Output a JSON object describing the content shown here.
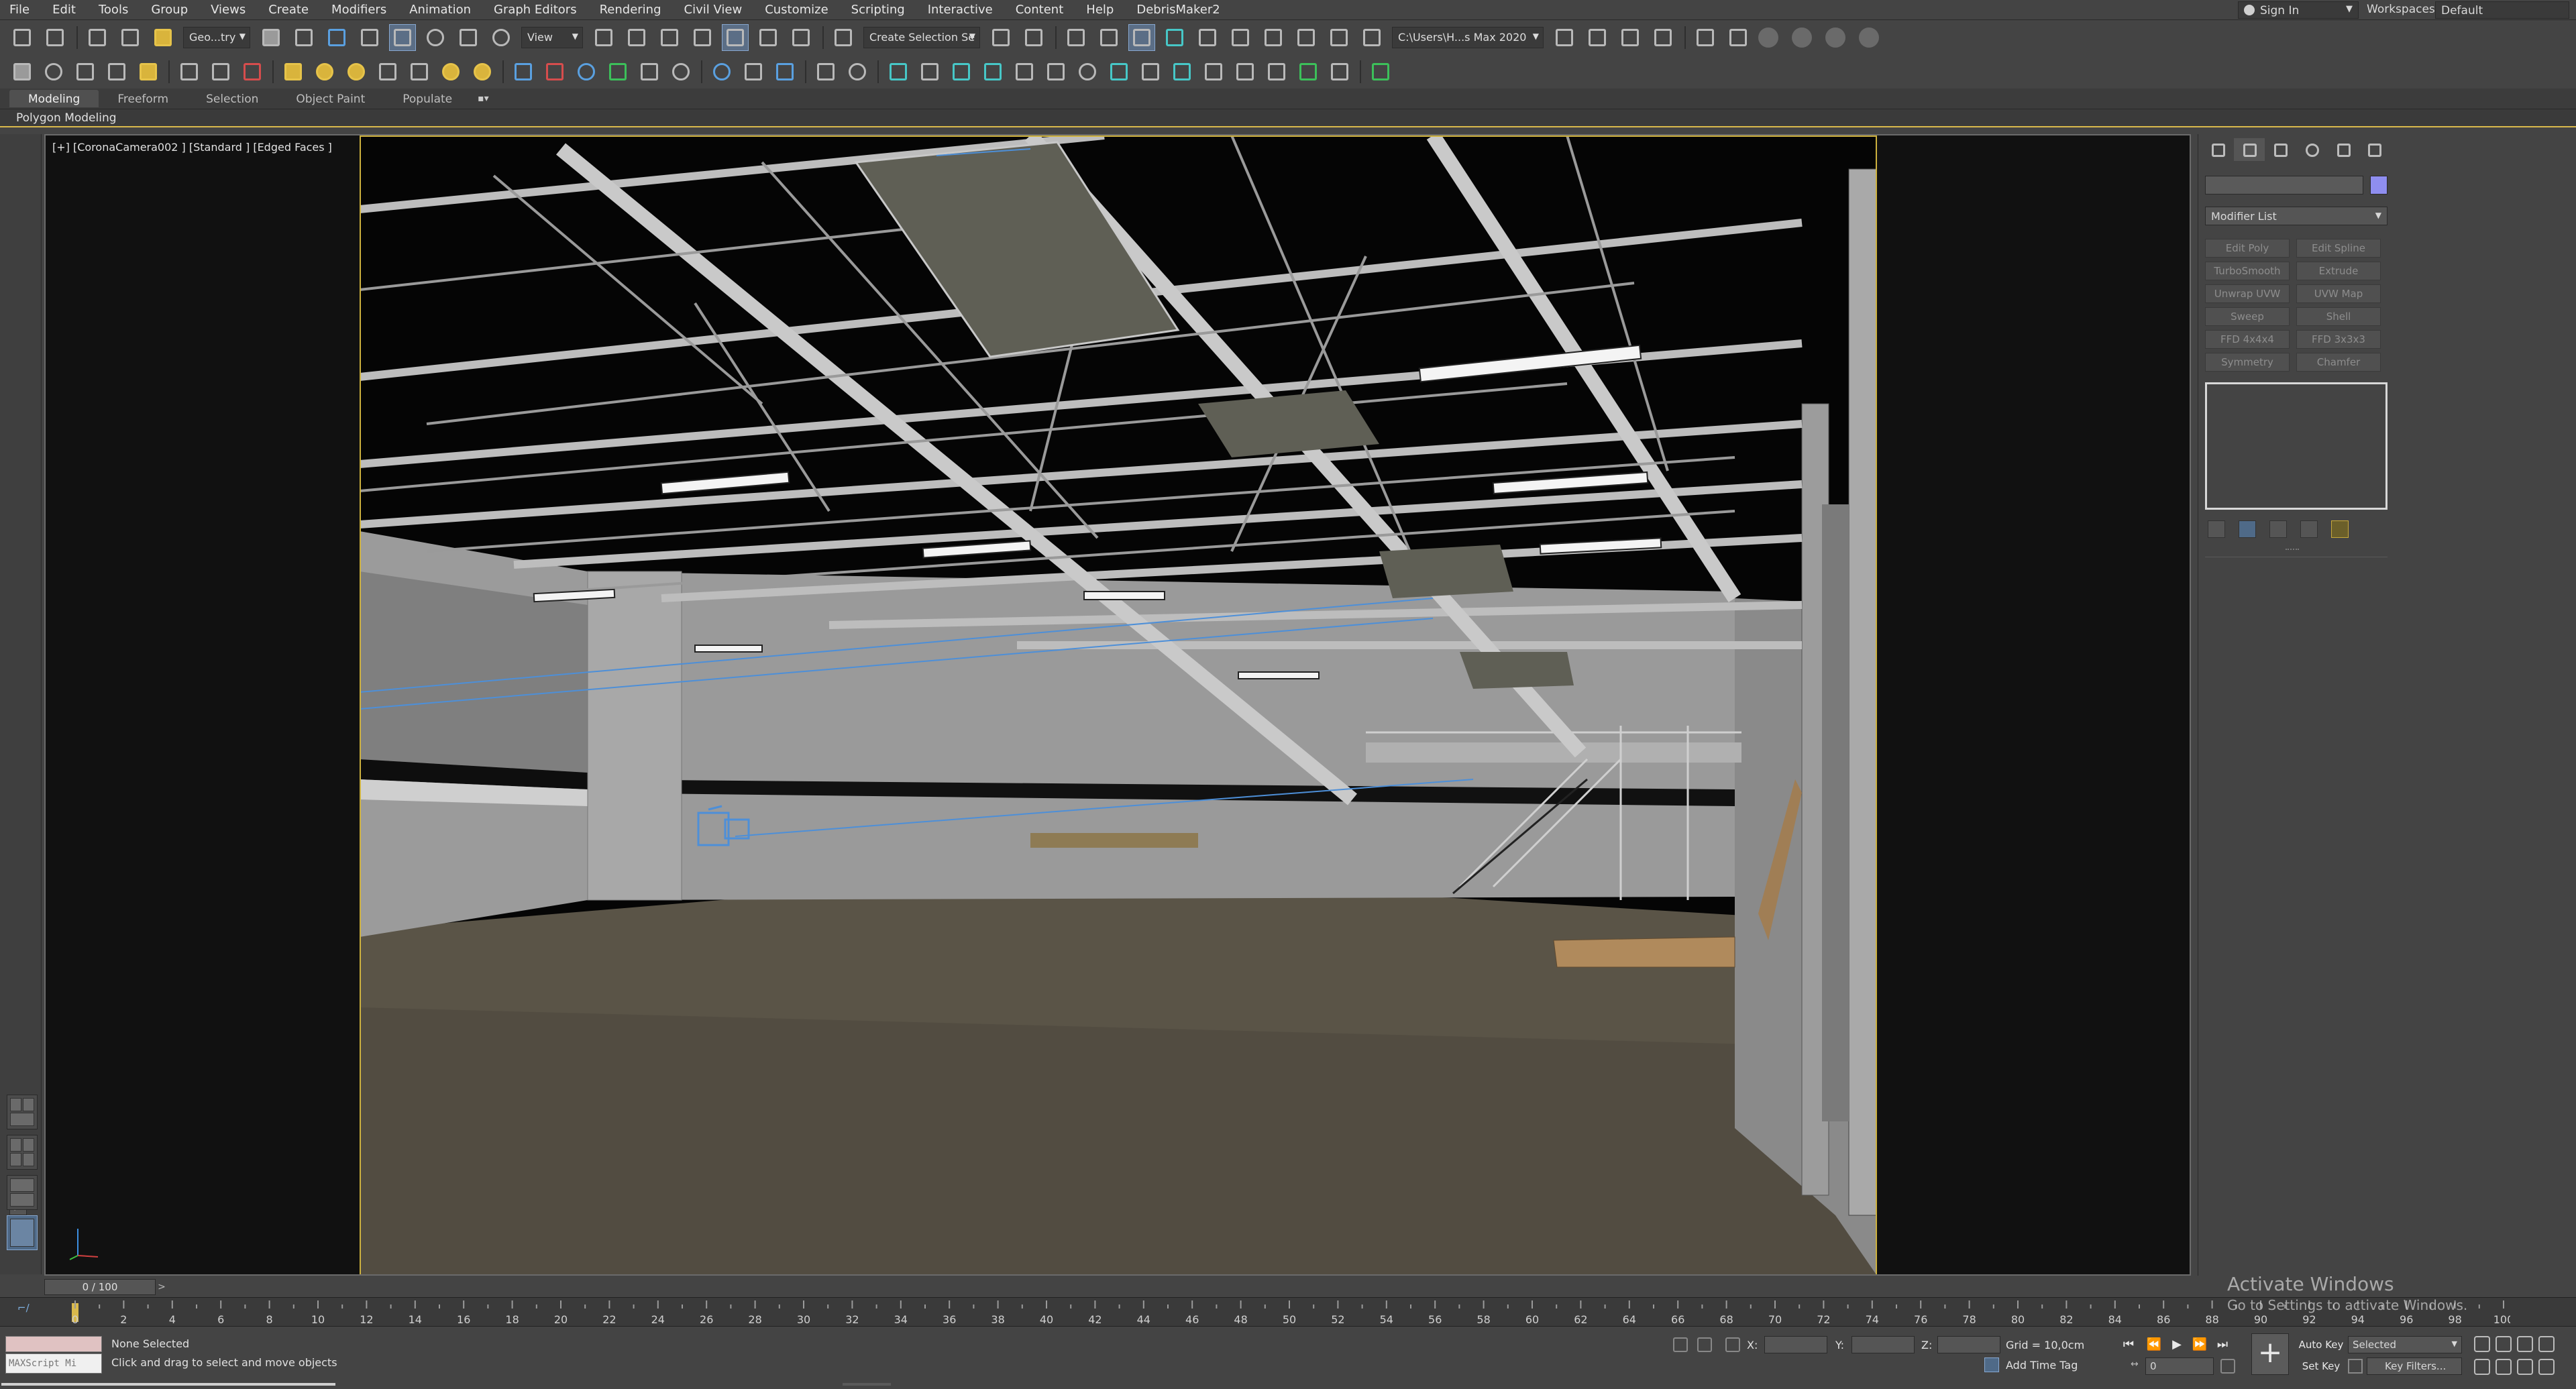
{
  "menubar": {
    "items": [
      "File",
      "Edit",
      "Tools",
      "Group",
      "Views",
      "Create",
      "Modifiers",
      "Animation",
      "Graph Editors",
      "Rendering",
      "Civil View",
      "Customize",
      "Scripting",
      "Interactive",
      "Content",
      "Help",
      "DebrisMaker2"
    ],
    "sign_in": "Sign In",
    "workspaces_label": "Workspaces:",
    "workspace": "Default"
  },
  "toolbar": {
    "selection_filter": "Geo...try",
    "reference_coord": "View",
    "named_selection": "Create Selection Se",
    "project_path": "C:\\Users\\H...s Max 2020"
  },
  "ribbon": {
    "tabs": [
      "Modeling",
      "Freeform",
      "Selection",
      "Object Paint",
      "Populate"
    ],
    "active_tab": "Modeling",
    "sub_label": "Polygon Modeling"
  },
  "viewport": {
    "label": "[+] [CoronaCamera002 ] [Standard ] [Edged Faces ]"
  },
  "command_panel": {
    "modifier_list": "Modifier List",
    "modifier_buttons": [
      "Edit Poly",
      "Edit Spline",
      "TurboSmooth",
      "Extrude",
      "Unwrap UVW",
      "UVW Map",
      "Sweep",
      "Shell",
      "FFD 4x4x4",
      "FFD 3x3x3",
      "Symmetry",
      "Chamfer"
    ],
    "object_color": "#8f8ef0"
  },
  "timeline": {
    "slider_label": "0 / 100",
    "current_frame": 0,
    "tick_labels": [
      "0",
      "2",
      "4",
      "6",
      "8",
      "10",
      "12",
      "14",
      "16",
      "18",
      "20",
      "22",
      "24",
      "26",
      "28",
      "30",
      "32",
      "34",
      "36",
      "38",
      "40",
      "42",
      "44",
      "46",
      "48",
      "50",
      "52",
      "54",
      "56",
      "58",
      "60",
      "62",
      "64",
      "66",
      "68",
      "70",
      "72",
      "74",
      "76",
      "78",
      "80",
      "82",
      "84",
      "86",
      "88",
      "90",
      "92",
      "94",
      "96",
      "98",
      "100"
    ]
  },
  "statusbar": {
    "maxscript_placeholder": "MAXScript Mi",
    "selection_status": "None Selected",
    "prompt": "Click and drag to select and move objects",
    "x_label": "X:",
    "y_label": "Y:",
    "z_label": "Z:",
    "grid": "Grid = 10,0cm",
    "add_time_tag": "Add Time Tag",
    "frame_value": "0",
    "auto_key": "Auto Key",
    "set_key": "Set Key",
    "key_mode_selected": "Selected",
    "key_filters": "Key Filters..."
  },
  "watermark": {
    "title": "Activate Windows",
    "subtitle": "Go to Settings to activate Windows."
  }
}
